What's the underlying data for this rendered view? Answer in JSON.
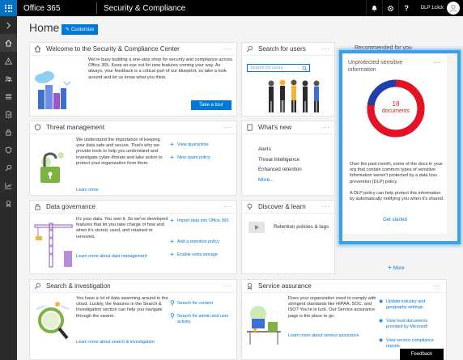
{
  "app": {
    "name": "Office 365",
    "title": "Security & Compliance",
    "user": "DLP 1click"
  },
  "nav": {
    "items": [
      "collapse",
      "home",
      "alerts",
      "permissions",
      "classifications",
      "data-loss-prevention",
      "data-governance",
      "threat-management",
      "search",
      "reports",
      "service-assurance"
    ]
  },
  "header": {
    "title": "Home",
    "customize": "Customize"
  },
  "welcome": {
    "title": "Welcome to the Security & Compliance Center",
    "text": "We're busy building a one-stop shop for security and compliance across Office 365. Keep an eye out for new features coming your way. As always, your feedback is a critical part of our blueprint, so take a look around and let us know what you think.",
    "button": "Take a tour"
  },
  "search_users": {
    "title": "Search for users",
    "placeholder": "Search for users"
  },
  "recommended": {
    "label": "Recommended for you"
  },
  "unprotected": {
    "title": "Unprotected sensitive information",
    "count": "18",
    "unit": "documents",
    "text1": "Over the past month, some of the docs in your org that contain common types of sensitive information weren't protected by a data loss prevention (DLP) policy.",
    "text2": "A DLP policy can help protect this information by automatically notifying you when it's shared.",
    "link": "Get started"
  },
  "threat": {
    "title": "Threat management",
    "text": "We understand the importance of keeping your data safe and secure. That's why we provide tools to help you understand and investigate cyber-threats and take action to protect your organization from them.",
    "learn": "Learn more",
    "actions": [
      "View quarantine",
      "New spam policy"
    ]
  },
  "whatsnew": {
    "title": "What's new",
    "items": [
      "Alerts",
      "Threat Intelligence",
      "Enhanced retention"
    ],
    "more": "More..."
  },
  "governance": {
    "title": "Data governance",
    "text": "It's your data. You own it. So we've developed features that let you take charge of how and when it's stored, used, and retained or removed.",
    "learn": "Learn more about data management",
    "actions": [
      "Import data into Office 365",
      "Add a retention policy",
      "Enable extra storage"
    ]
  },
  "discover": {
    "title": "Discover & learn",
    "item": "Retention policies & tags"
  },
  "more": "More",
  "search_investigation": {
    "title": "Search & investigation",
    "text": "You have a lot of data swarming around in the cloud. Luckily, the features in the Search & Investigation section can help you navigate through the swarm.",
    "learn": "Learn more about search & investigation",
    "actions": [
      "Search for content",
      "Search for admin and user activity"
    ]
  },
  "service": {
    "title": "Service assurance",
    "text": "Does your organization need to comply with stringent standards like HIPAA, SOC, and ISO? You're in luck. Our Service assurance page is the place to go.",
    "learn": "Learn more about service assurance",
    "actions": [
      "Update industry and geography settings",
      "View trust documents provided by Microsoft",
      "View service compliance reports"
    ]
  },
  "feedback": "Feedback",
  "colors": {
    "accent": "#0078d7",
    "highlight": "#3aa0e8",
    "donut_red": "#e81123",
    "donut_blue": "#1f3fa8"
  }
}
